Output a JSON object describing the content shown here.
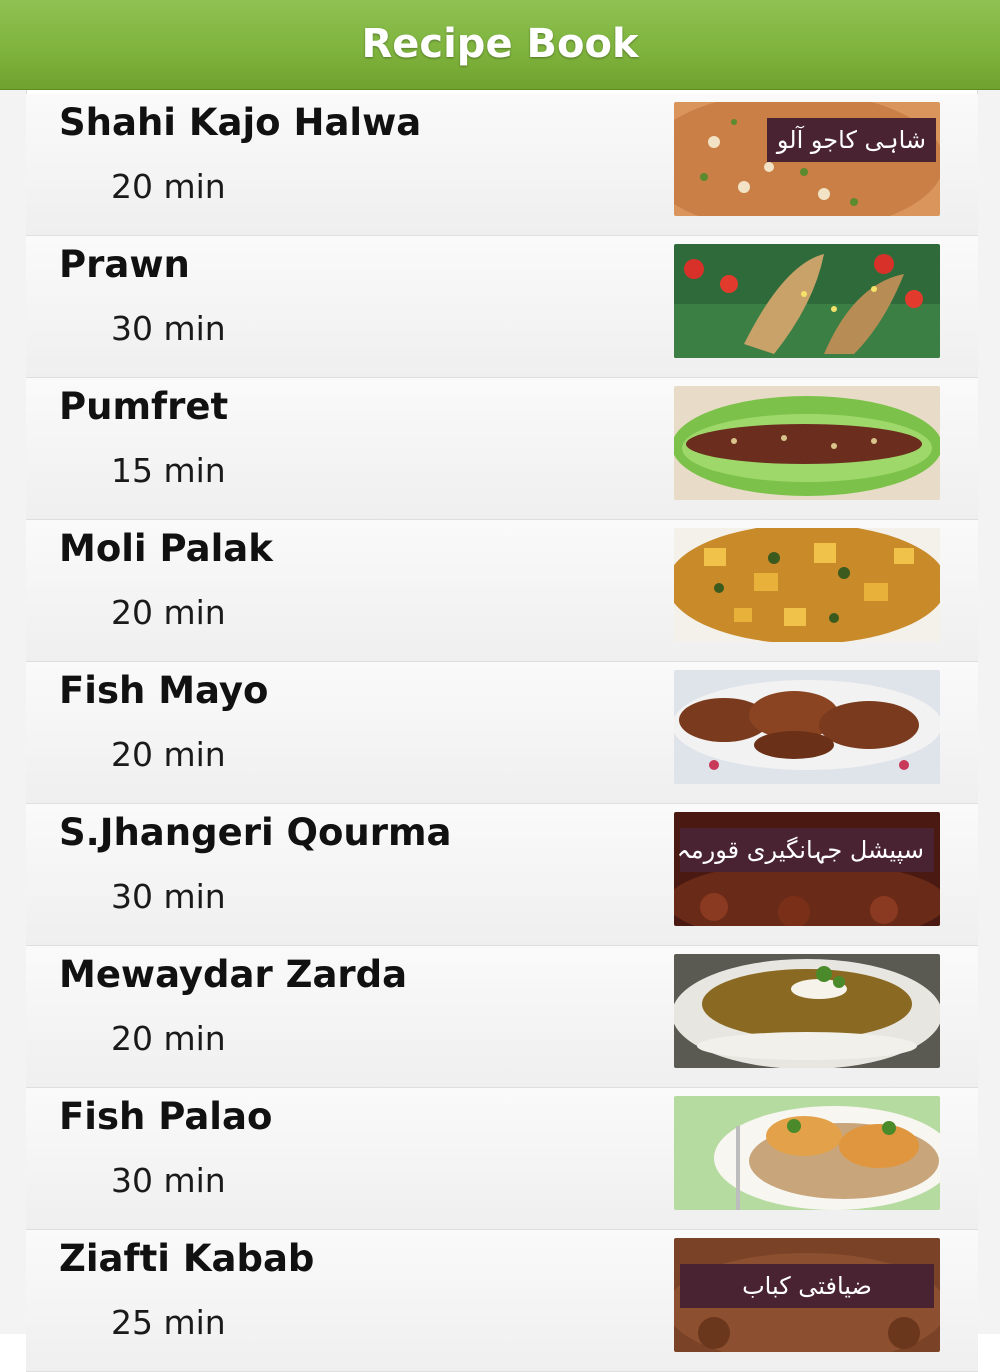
{
  "header": {
    "title": "Recipe Book"
  },
  "recipes": [
    {
      "name": "Shahi Kajo Halwa",
      "time": "20 min",
      "image_label": "شاہی کاجو آلو",
      "image_icon": "halwa-dish-image"
    },
    {
      "name": "Prawn",
      "time": "30 min",
      "image_label": "",
      "image_icon": "prawn-dish-image"
    },
    {
      "name": "Pumfret",
      "time": "15 min",
      "image_label": "",
      "image_icon": "pumfret-dish-image"
    },
    {
      "name": "Moli Palak",
      "time": "20 min",
      "image_label": "",
      "image_icon": "moli-palak-dish-image"
    },
    {
      "name": "Fish Mayo",
      "time": "20 min",
      "image_label": "",
      "image_icon": "fish-mayo-dish-image"
    },
    {
      "name": "S.Jhangeri Qourma",
      "time": "30 min",
      "image_label": "سپیشل جہانگیری قورمہ",
      "image_icon": "qourma-dish-image"
    },
    {
      "name": "Mewaydar Zarda",
      "time": "20 min",
      "image_label": "",
      "image_icon": "zarda-dish-image"
    },
    {
      "name": "Fish Palao",
      "time": "30 min",
      "image_label": "",
      "image_icon": "fish-palao-dish-image"
    },
    {
      "name": "Ziafti Kabab",
      "time": "25 min",
      "image_label": "ضیافتی کباب",
      "image_icon": "kabab-dish-image"
    }
  ],
  "colors": {
    "header_green": "#7fb43e",
    "label_maroon": "#4a2333",
    "row_background": "#f4f4f4"
  }
}
